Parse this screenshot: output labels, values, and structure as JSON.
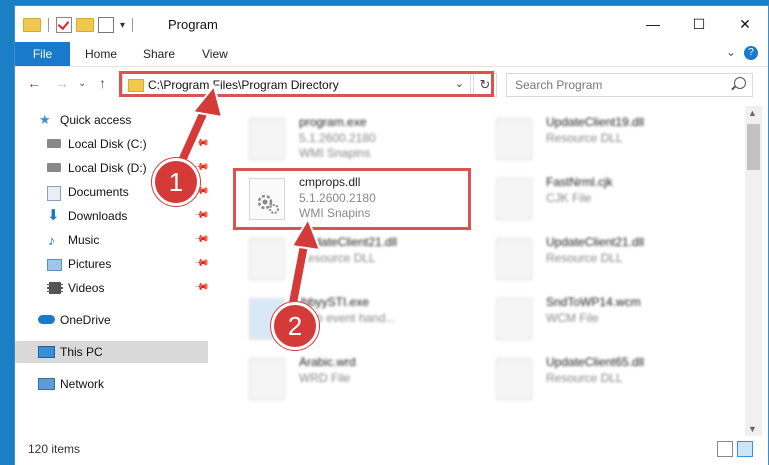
{
  "window": {
    "title": "Program",
    "controls": [
      "—",
      "☐",
      "✕"
    ]
  },
  "ribbon": {
    "file_tab": "File",
    "tabs": [
      "Home",
      "Share",
      "View"
    ],
    "help_icon": "?"
  },
  "navigation": {
    "back": "←",
    "forward": "→",
    "up_icon": "↑",
    "path": "C:\\Program Files\\Program Directory",
    "refresh_icon": "↻",
    "search_placeholder": "Search Program"
  },
  "sidebar": {
    "items": [
      {
        "label": "Quick access",
        "icon": "star-icon"
      },
      {
        "label": "Local Disk (C:)",
        "icon": "drive-icon"
      },
      {
        "label": "Local Disk (D:)",
        "icon": "drive-icon"
      },
      {
        "label": "Documents",
        "icon": "documents-icon"
      },
      {
        "label": "Downloads",
        "icon": "download-icon"
      },
      {
        "label": "Music",
        "icon": "music-icon"
      },
      {
        "label": "Pictures",
        "icon": "pictures-icon"
      },
      {
        "label": "Videos",
        "icon": "videos-icon"
      },
      {
        "label": "OneDrive",
        "icon": "cloud-icon"
      },
      {
        "label": "This PC",
        "icon": "pc-icon"
      },
      {
        "label": "Network",
        "icon": "network-icon"
      }
    ]
  },
  "files": {
    "left": [
      {
        "name": "program.exe",
        "line2": "5.1.2600.2180",
        "line3": "WMI Snapins"
      },
      {
        "name": "cmprops.dll",
        "line2": "5.1.2600.2180",
        "line3": "WMI Snapins"
      },
      {
        "name": "UpdateClient21.dll",
        "line2": "Resource DLL",
        "line3": ""
      },
      {
        "name": "IbbyySTI.exe",
        "line2": "Y sb event hand...",
        "line3": ""
      },
      {
        "name": "Arabic.wrd",
        "line2": "WRD File",
        "line3": ""
      }
    ],
    "right": [
      {
        "name": "UpdateClient19.dll",
        "line2": "Resource DLL"
      },
      {
        "name": "FastNrml.cjk",
        "line2": "CJK File"
      },
      {
        "name": "UpdateClient21.dll",
        "line2": "Resource DLL"
      },
      {
        "name": "SndToWP14.wcm",
        "line2": "WCM File"
      },
      {
        "name": "UpdateClient65.dll",
        "line2": "Resource DLL"
      }
    ]
  },
  "status": {
    "item_count": "120 items"
  },
  "callouts": [
    "1",
    "2"
  ],
  "colors": {
    "accent": "#1979ca",
    "highlight": "#d9534f",
    "selected": "#d9d9d9"
  }
}
